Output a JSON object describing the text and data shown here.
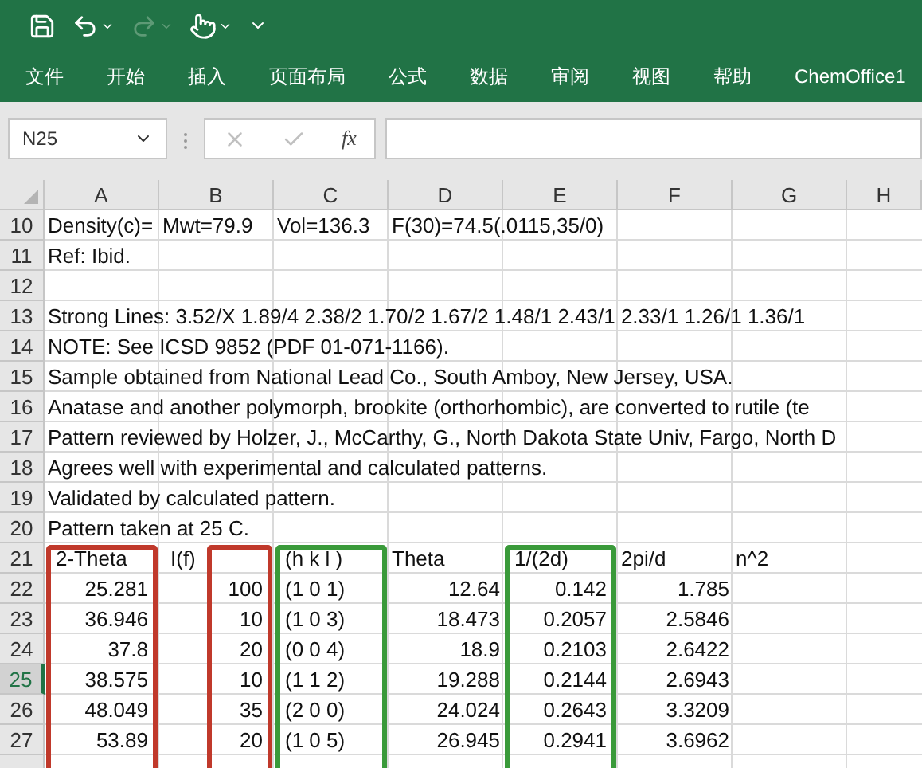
{
  "quick_access": [
    {
      "kind": "save",
      "disabled": false
    },
    {
      "kind": "undo",
      "disabled": false
    },
    {
      "kind": "redo",
      "disabled": true
    },
    {
      "kind": "touch",
      "disabled": false
    },
    {
      "kind": "customize",
      "disabled": false
    }
  ],
  "ribbon_tabs": [
    "文件",
    "开始",
    "插入",
    "页面布局",
    "公式",
    "数据",
    "审阅",
    "视图",
    "帮助",
    "ChemOffice1"
  ],
  "formula_bar": {
    "name_box": "N25",
    "function_label": "fx"
  },
  "columns": [
    {
      "label": "A"
    },
    {
      "label": "B"
    },
    {
      "label": "C"
    },
    {
      "label": "D"
    },
    {
      "label": "E"
    },
    {
      "label": "F"
    },
    {
      "label": "G"
    },
    {
      "label": "H"
    }
  ],
  "rows": [
    {
      "number": "10",
      "selected": false,
      "cells": [
        {
          "kind": "text",
          "text": "Density(c)="
        },
        {
          "kind": "text",
          "text": "Mwt=79.9"
        },
        {
          "kind": "text",
          "text": "Vol=136.3"
        },
        {
          "kind": "text",
          "text": "F(30)=74.5(.0115,35/0)"
        }
      ]
    },
    {
      "number": "11",
      "selected": false,
      "cells": [
        {
          "kind": "text",
          "text": "Ref: Ibid."
        }
      ]
    },
    {
      "number": "12",
      "selected": false,
      "cells": []
    },
    {
      "number": "13",
      "selected": false,
      "cells": [
        {
          "kind": "text",
          "text": "Strong Lines: 3.52/X 1.89/4 2.38/2 1.70/2 1.67/2 1.48/1 2.43/1 2.33/1 1.26/1 1.36/1"
        }
      ]
    },
    {
      "number": "14",
      "selected": false,
      "cells": [
        {
          "kind": "text",
          "text": "NOTE:  See ICSD 9852 (PDF 01-071-1166)."
        }
      ]
    },
    {
      "number": "15",
      "selected": false,
      "cells": [
        {
          "kind": "text",
          "text": "Sample obtained from National Lead Co., South Amboy, New Jersey, USA."
        }
      ]
    },
    {
      "number": "16",
      "selected": false,
      "cells": [
        {
          "kind": "text",
          "text": "Anatase and another polymorph, brookite (orthorhombic), are converted to rutile (te"
        }
      ]
    },
    {
      "number": "17",
      "selected": false,
      "cells": [
        {
          "kind": "text",
          "text": "Pattern reviewed by Holzer, J., McCarthy, G., North Dakota State Univ, Fargo, North D"
        }
      ]
    },
    {
      "number": "18",
      "selected": false,
      "cells": [
        {
          "kind": "text",
          "text": "Agrees well with experimental and calculated patterns."
        }
      ]
    },
    {
      "number": "19",
      "selected": false,
      "cells": [
        {
          "kind": "text",
          "text": "Validated by calculated pattern."
        }
      ]
    },
    {
      "number": "20",
      "selected": false,
      "cells": [
        {
          "kind": "text",
          "text": "Pattern taken at 25 C."
        }
      ]
    },
    {
      "number": "21",
      "selected": false,
      "cells": [
        {
          "kind": "text",
          "text": "2-Theta",
          "frame": {
            "color": "#c0392b"
          }
        },
        {
          "kind": "text",
          "text": "I(f)",
          "frame": {
            "color": "#c0392b"
          }
        },
        {
          "kind": "text",
          "text": "(h k l )",
          "frame": {
            "color": "#3a9a3a"
          }
        },
        {
          "kind": "text",
          "text": "Theta"
        },
        {
          "kind": "text",
          "text": "1/(2d)",
          "frame": {
            "color": "#3a9a3a"
          }
        },
        {
          "kind": "text",
          "text": "2pi/d"
        },
        {
          "kind": "text",
          "text": "n^2"
        }
      ]
    },
    {
      "number": "22",
      "selected": false,
      "cells": [
        {
          "kind": "number",
          "text": "25.281"
        },
        {
          "kind": "number",
          "text": "100"
        },
        {
          "kind": "text",
          "text": "(1 0 1)"
        },
        {
          "kind": "number",
          "text": "12.64"
        },
        {
          "kind": "number",
          "text": "0.142"
        },
        {
          "kind": "number",
          "text": "1.785"
        }
      ]
    },
    {
      "number": "23",
      "selected": false,
      "cells": [
        {
          "kind": "number",
          "text": "36.946"
        },
        {
          "kind": "number",
          "text": "10"
        },
        {
          "kind": "text",
          "text": "(1 0 3)"
        },
        {
          "kind": "number",
          "text": "18.473"
        },
        {
          "kind": "number",
          "text": "0.2057"
        },
        {
          "kind": "number",
          "text": "2.5846"
        }
      ]
    },
    {
      "number": "24",
      "selected": false,
      "cells": [
        {
          "kind": "number",
          "text": "37.8"
        },
        {
          "kind": "number",
          "text": "20"
        },
        {
          "kind": "text",
          "text": "(0 0 4)"
        },
        {
          "kind": "number",
          "text": "18.9"
        },
        {
          "kind": "number",
          "text": "0.2103"
        },
        {
          "kind": "number",
          "text": "2.6422"
        }
      ]
    },
    {
      "number": "25",
      "selected": true,
      "cells": [
        {
          "kind": "number",
          "text": "38.575"
        },
        {
          "kind": "number",
          "text": "10"
        },
        {
          "kind": "text",
          "text": "(1 1 2)"
        },
        {
          "kind": "number",
          "text": "19.288"
        },
        {
          "kind": "number",
          "text": "0.2144"
        },
        {
          "kind": "number",
          "text": "2.6943"
        }
      ]
    },
    {
      "number": "26",
      "selected": false,
      "cells": [
        {
          "kind": "number",
          "text": "48.049"
        },
        {
          "kind": "number",
          "text": "35"
        },
        {
          "kind": "text",
          "text": "(2 0 0)"
        },
        {
          "kind": "number",
          "text": "24.024"
        },
        {
          "kind": "number",
          "text": "0.2643"
        },
        {
          "kind": "number",
          "text": "3.3209"
        }
      ]
    },
    {
      "number": "27",
      "selected": false,
      "cells": [
        {
          "kind": "number",
          "text": "53.89"
        },
        {
          "kind": "number",
          "text": "20"
        },
        {
          "kind": "text",
          "text": "(1 0 5)"
        },
        {
          "kind": "number",
          "text": "26.945"
        },
        {
          "kind": "number",
          "text": "0.2941"
        },
        {
          "kind": "number",
          "text": "3.6962"
        }
      ]
    }
  ]
}
